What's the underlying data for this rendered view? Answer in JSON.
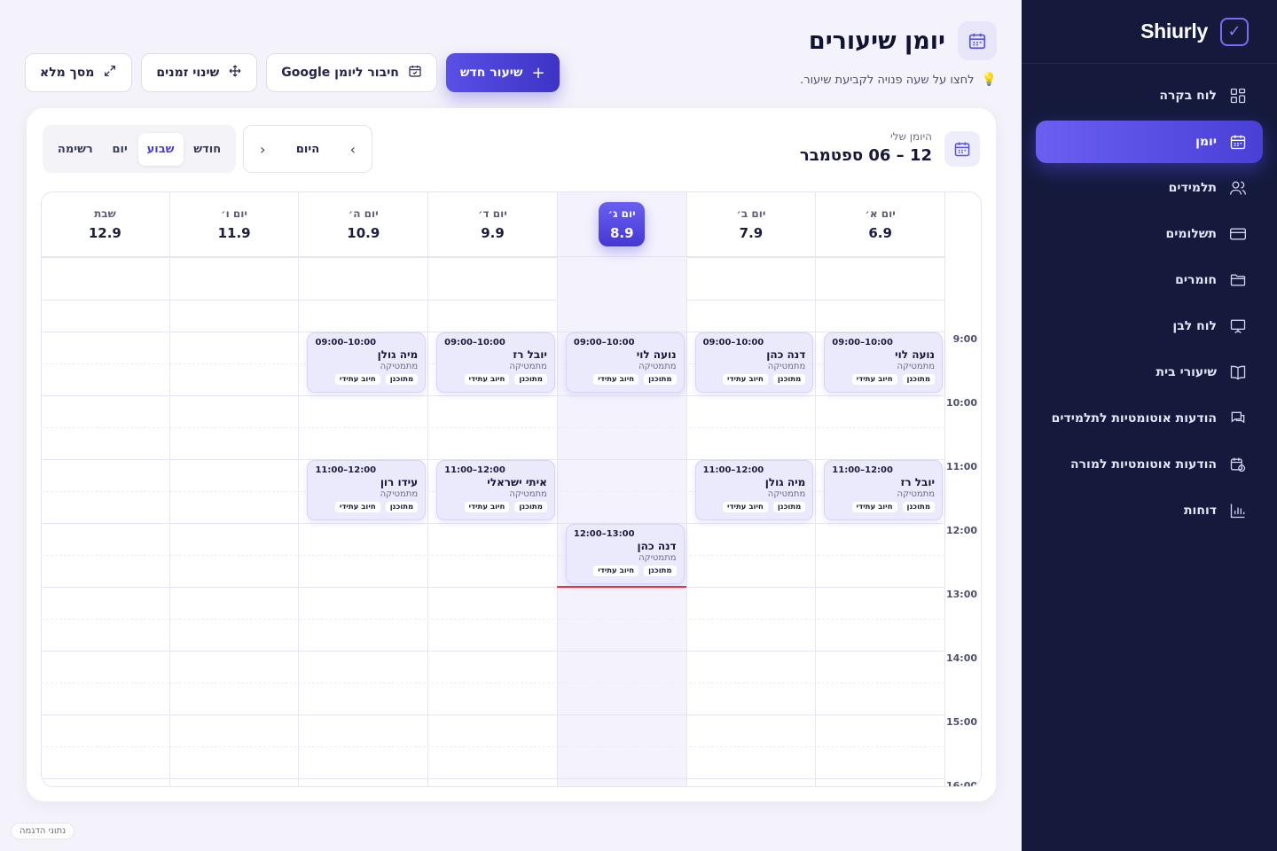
{
  "app": {
    "name": "Shiurly"
  },
  "sidebar": {
    "items": [
      {
        "label": "לוח בקרה",
        "icon": "dashboard-icon",
        "active": false
      },
      {
        "label": "יומן",
        "icon": "calendar-icon",
        "active": true
      },
      {
        "label": "תלמידים",
        "icon": "users-icon",
        "active": false
      },
      {
        "label": "תשלומים",
        "icon": "credit-card-icon",
        "active": false
      },
      {
        "label": "חומרים",
        "icon": "folder-icon",
        "active": false
      },
      {
        "label": "לוח לבן",
        "icon": "whiteboard-icon",
        "active": false
      },
      {
        "label": "שיעורי בית",
        "icon": "book-icon",
        "active": false
      },
      {
        "label": "הודעות אוטומטיות לתלמידים",
        "icon": "chat-icon",
        "active": false
      },
      {
        "label": "הודעות אוטומטיות למורה",
        "icon": "alarm-icon",
        "active": false
      },
      {
        "label": "דוחות",
        "icon": "bar-chart-icon",
        "active": false
      }
    ]
  },
  "header": {
    "title": "יומן שיעורים",
    "hint": "לחצו על שעה פנויה לקביעת שיעור.",
    "buttons": {
      "new_lesson": "שיעור חדש",
      "google": "חיבור ליומן Google",
      "reschedule": "שינוי זמנים",
      "fullscreen": "מסך מלא"
    }
  },
  "calendar": {
    "my_calendar_label": "היומן שלי",
    "range": "12 – 06 ספטמבר",
    "today_label": "היום",
    "views": [
      "חודש",
      "שבוע",
      "יום",
      "רשימה"
    ],
    "active_view": "שבוע",
    "days": [
      {
        "name": "יום א׳",
        "date": "6.9",
        "today": false
      },
      {
        "name": "יום ב׳",
        "date": "7.9",
        "today": false
      },
      {
        "name": "יום ג׳",
        "date": "8.9",
        "today": true
      },
      {
        "name": "יום ד׳",
        "date": "9.9",
        "today": false
      },
      {
        "name": "יום ה׳",
        "date": "10.9",
        "today": false
      },
      {
        "name": "יום ו׳",
        "date": "11.9",
        "today": false
      },
      {
        "name": "שבת",
        "date": "12.9",
        "today": false
      }
    ],
    "hours": [
      "9:00",
      "10:00",
      "11:00",
      "12:00",
      "13:00",
      "14:00",
      "15:00",
      "16:00"
    ],
    "events": [
      {
        "day": 0,
        "start": 9,
        "time": "09:00–10:00",
        "student": "נועה לוי",
        "subject": "מתמטיקה",
        "tags": [
          "מתוכנן",
          "חיוב עתידי"
        ]
      },
      {
        "day": 1,
        "start": 9,
        "time": "09:00–10:00",
        "student": "דנה כהן",
        "subject": "מתמטיקה",
        "tags": [
          "מתוכנן",
          "חיוב עתידי"
        ]
      },
      {
        "day": 2,
        "start": 9,
        "time": "09:00–10:00",
        "student": "נועה לוי",
        "subject": "מתמטיקה",
        "tags": [
          "מתוכנן",
          "חיוב עתידי"
        ]
      },
      {
        "day": 3,
        "start": 9,
        "time": "09:00–10:00",
        "student": "יובל רז",
        "subject": "מתמטיקה",
        "tags": [
          "מתוכנן",
          "חיוב עתידי"
        ]
      },
      {
        "day": 4,
        "start": 9,
        "time": "09:00–10:00",
        "student": "מיה גולן",
        "subject": "מתמטיקה",
        "tags": [
          "מתוכנן",
          "חיוב עתידי"
        ]
      },
      {
        "day": 0,
        "start": 11,
        "time": "11:00–12:00",
        "student": "יובל רז",
        "subject": "מתמטיקה",
        "tags": [
          "מתוכנן",
          "חיוב עתידי"
        ]
      },
      {
        "day": 1,
        "start": 11,
        "time": "11:00–12:00",
        "student": "מיה גולן",
        "subject": "מתמטיקה",
        "tags": [
          "מתוכנן",
          "חיוב עתידי"
        ]
      },
      {
        "day": 3,
        "start": 11,
        "time": "11:00–12:00",
        "student": "איתי ישראלי",
        "subject": "מתמטיקה",
        "tags": [
          "מתוכנן",
          "חיוב עתידי"
        ]
      },
      {
        "day": 4,
        "start": 11,
        "time": "11:00–12:00",
        "student": "עידו רון",
        "subject": "מתמטיקה",
        "tags": [
          "מתוכנן",
          "חיוב עתידי"
        ]
      },
      {
        "day": 2,
        "start": 12,
        "time": "12:00–13:00",
        "student": "דנה כהן",
        "subject": "מתמטיקה",
        "tags": [
          "מתוכנן",
          "חיוב עתידי"
        ]
      }
    ],
    "now_time": "13:00"
  },
  "footer": {
    "sample_badge": "נתוני הדגמה"
  },
  "colors": {
    "accent": "#5a4fe6",
    "sidebar_bg": "#151a3d",
    "now_line": "#e0353e"
  }
}
